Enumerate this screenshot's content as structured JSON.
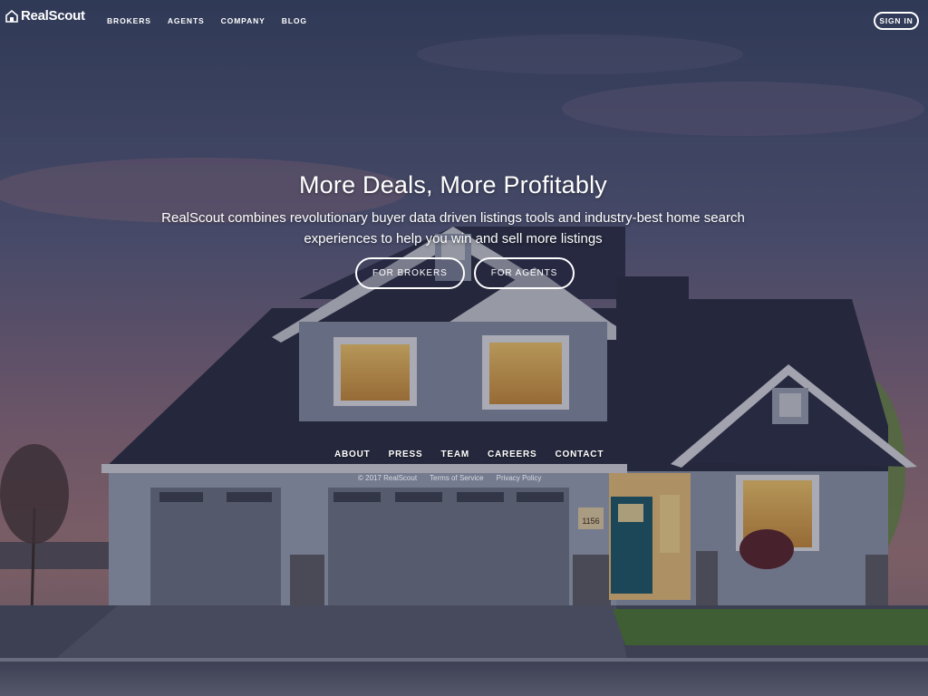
{
  "brand": {
    "name": "RealScout",
    "logo_icon": "house-flag-icon"
  },
  "nav": {
    "links": [
      "BROKERS",
      "AGENTS",
      "COMPANY",
      "BLOG"
    ],
    "signin_label": "SIGN IN"
  },
  "hero": {
    "headline": "More Deals, More Profitably",
    "subtitle": "RealScout combines revolutionary buyer data driven listings tools and industry-best home search experiences to help you win and sell more listings",
    "cta_brokers": "FOR BROKERS",
    "cta_agents": "FOR AGENTS"
  },
  "footer": {
    "links": [
      "ABOUT",
      "PRESS",
      "TEAM",
      "CAREERS",
      "CONTACT"
    ],
    "copyright": "© 2017 RealScout",
    "terms": "Terms of Service",
    "privacy": "Privacy Policy"
  },
  "house_number": "1156",
  "colors": {
    "sky_top": "#3b4a6e",
    "sky_bottom": "#8a6a7a",
    "roof": "#2c3046",
    "siding": "#8892a6",
    "door": "#1f5a6b",
    "window_glow": "#e8b860"
  }
}
